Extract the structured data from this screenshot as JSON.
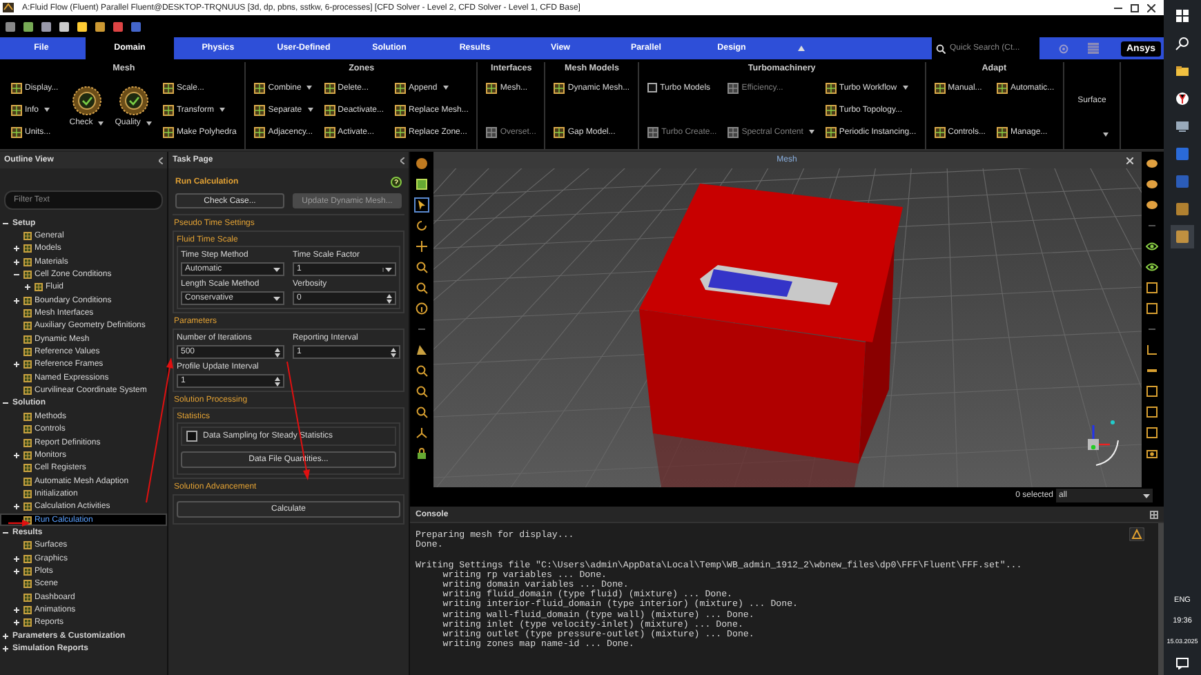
{
  "window": {
    "title": "A:Fluid Flow (Fluent) Parallel Fluent@DESKTOP-TRQNUUS  [3d, dp, pbns, sstkw, 6-processes] [CFD Solver - Level 2, CFD Solver - Level 1, CFD Base]"
  },
  "tabs": [
    {
      "label": "File",
      "selected": false
    },
    {
      "label": "Domain",
      "selected": true
    },
    {
      "label": "Physics",
      "selected": false
    },
    {
      "label": "User-Defined",
      "selected": false
    },
    {
      "label": "Solution",
      "selected": false
    },
    {
      "label": "Results",
      "selected": false
    },
    {
      "label": "View",
      "selected": false
    },
    {
      "label": "Parallel",
      "selected": false
    },
    {
      "label": "Design",
      "selected": false
    }
  ],
  "search": {
    "placeholder": "Quick Search (Ct..."
  },
  "brand": "Ansys",
  "ribbon": {
    "groups": [
      {
        "title": "Mesh",
        "kind": "full",
        "columns": [
          [
            {
              "label": "Display...",
              "kind": "small",
              "dropdown": false,
              "disabled": false
            },
            {
              "label": "Info",
              "kind": "small",
              "dropdown": true,
              "disabled": false
            },
            {
              "label": "Units...",
              "kind": "small",
              "dropdown": false,
              "disabled": false
            }
          ],
          [
            {
              "label": "Check",
              "kind": "large",
              "dropdown": true,
              "disabled": false
            }
          ],
          [
            {
              "label": "Quality",
              "kind": "large",
              "dropdown": true,
              "disabled": false
            }
          ],
          [
            {
              "label": "Scale...",
              "kind": "small",
              "dropdown": false,
              "disabled": false
            },
            {
              "label": "Transform",
              "kind": "small",
              "dropdown": true,
              "disabled": false
            },
            {
              "label": "Make Polyhedra",
              "kind": "small",
              "dropdown": false,
              "disabled": false
            }
          ]
        ]
      },
      {
        "title": "Zones",
        "kind": "full",
        "columns": [
          [
            {
              "label": "Combine",
              "kind": "small",
              "dropdown": true,
              "disabled": false
            },
            {
              "label": "Separate",
              "kind": "small",
              "dropdown": true,
              "disabled": false
            },
            {
              "label": "Adjacency...",
              "kind": "small",
              "dropdown": false,
              "disabled": false
            }
          ],
          [
            {
              "label": "Delete...",
              "kind": "small",
              "dropdown": false,
              "disabled": false
            },
            {
              "label": "Deactivate...",
              "kind": "small",
              "dropdown": false,
              "disabled": false
            },
            {
              "label": "Activate...",
              "kind": "small",
              "dropdown": false,
              "disabled": false
            }
          ],
          [
            {
              "label": "Append",
              "kind": "small",
              "dropdown": true,
              "disabled": false
            },
            {
              "label": "Replace Mesh...",
              "kind": "small",
              "dropdown": false,
              "disabled": false
            },
            {
              "label": "Replace Zone...",
              "kind": "small",
              "dropdown": false,
              "disabled": false
            }
          ]
        ]
      },
      {
        "title": "Interfaces",
        "kind": "full",
        "columns": [
          [
            {
              "label": "Mesh...",
              "kind": "small",
              "dropdown": false,
              "disabled": false
            },
            {
              "label": "Overset...",
              "kind": "small",
              "dropdown": false,
              "disabled": true
            }
          ]
        ]
      },
      {
        "title": "Mesh Models",
        "kind": "full",
        "columns": [
          [
            {
              "label": "Dynamic Mesh...",
              "kind": "small",
              "dropdown": false,
              "disabled": false
            },
            {
              "label": "Gap Model...",
              "kind": "small",
              "dropdown": false,
              "disabled": false
            }
          ]
        ]
      },
      {
        "title": "Turbomachinery",
        "kind": "full",
        "columns": [
          [
            {
              "label": "Turbo Models",
              "kind": "checkbox",
              "checked": false,
              "disabled": false
            },
            {
              "label": "Turbo Create...",
              "kind": "small",
              "dropdown": false,
              "disabled": true
            }
          ],
          [
            {
              "label": "Efficiency...",
              "kind": "small",
              "dropdown": false,
              "disabled": true
            },
            {
              "label": "Spectral Content",
              "kind": "small",
              "dropdown": true,
              "disabled": true
            }
          ],
          [
            {
              "label": "Turbo Workflow",
              "kind": "small",
              "dropdown": true,
              "disabled": false
            },
            {
              "label": "Turbo Topology...",
              "kind": "small",
              "dropdown": false,
              "disabled": false
            },
            {
              "label": "Periodic Instancing...",
              "kind": "small",
              "dropdown": false,
              "disabled": false
            }
          ]
        ]
      },
      {
        "title": "Adapt",
        "kind": "full",
        "columns": [
          [
            {
              "label": "Manual...",
              "kind": "small",
              "dropdown": false,
              "disabled": false
            },
            {
              "label": "Controls...",
              "kind": "small",
              "dropdown": false,
              "disabled": false
            }
          ],
          [
            {
              "label": "Automatic...",
              "kind": "small",
              "dropdown": false,
              "disabled": false
            },
            {
              "label": "Manage...",
              "kind": "small",
              "dropdown": false,
              "disabled": false
            }
          ]
        ]
      },
      {
        "title": "Surface",
        "kind": "collapsed"
      }
    ]
  },
  "outline": {
    "title": "Outline View",
    "filter": {
      "placeholder": "Filter Text"
    },
    "tree": [
      {
        "label": "Setup",
        "expanded": true,
        "selected": false,
        "children": [
          {
            "label": "General",
            "selected": false
          },
          {
            "label": "Models",
            "expanded": false,
            "selected": false
          },
          {
            "label": "Materials",
            "expanded": false,
            "selected": false
          },
          {
            "label": "Cell Zone Conditions",
            "expanded": true,
            "selected": false,
            "children": [
              {
                "label": "Fluid",
                "expanded": false,
                "selected": false
              }
            ]
          },
          {
            "label": "Boundary Conditions",
            "expanded": false,
            "selected": false
          },
          {
            "label": "Mesh Interfaces",
            "selected": false
          },
          {
            "label": "Auxiliary Geometry Definitions",
            "selected": false
          },
          {
            "label": "Dynamic Mesh",
            "selected": false
          },
          {
            "label": "Reference Values",
            "selected": false
          },
          {
            "label": "Reference Frames",
            "expanded": false,
            "selected": false
          },
          {
            "label": "Named Expressions",
            "selected": false
          },
          {
            "label": "Curvilinear Coordinate System",
            "selected": false
          }
        ]
      },
      {
        "label": "Solution",
        "expanded": true,
        "selected": false,
        "children": [
          {
            "label": "Methods",
            "selected": false
          },
          {
            "label": "Controls",
            "selected": false
          },
          {
            "label": "Report Definitions",
            "selected": false
          },
          {
            "label": "Monitors",
            "expanded": false,
            "selected": false
          },
          {
            "label": "Cell Registers",
            "selected": false
          },
          {
            "label": "Automatic Mesh Adaption",
            "selected": false
          },
          {
            "label": "Initialization",
            "selected": false
          },
          {
            "label": "Calculation Activities",
            "expanded": false,
            "selected": false
          },
          {
            "label": "Run Calculation",
            "selected": true
          }
        ]
      },
      {
        "label": "Results",
        "expanded": true,
        "selected": false,
        "children": [
          {
            "label": "Surfaces",
            "selected": false
          },
          {
            "label": "Graphics",
            "expanded": false,
            "selected": false
          },
          {
            "label": "Plots",
            "expanded": false,
            "selected": false
          },
          {
            "label": "Scene",
            "selected": false
          },
          {
            "label": "Dashboard",
            "selected": false
          },
          {
            "label": "Animations",
            "expanded": false,
            "selected": false
          },
          {
            "label": "Reports",
            "expanded": false,
            "selected": false
          }
        ]
      },
      {
        "label": "Parameters & Customization",
        "expanded": false,
        "selected": false
      },
      {
        "label": "Simulation Reports",
        "expanded": false,
        "selected": false
      }
    ]
  },
  "task_page": {
    "title": "Task Page",
    "heading": "Run Calculation",
    "top_buttons": [
      {
        "label": "Check Case...",
        "disabled": false
      },
      {
        "label": "Update Dynamic Mesh...",
        "disabled": true
      }
    ],
    "sections": [
      {
        "title": "Pseudo Time Settings",
        "box_title": "Fluid Time Scale",
        "items": [
          {
            "kind": "dropdown",
            "label": "Time Step Method",
            "value": "Automatic"
          },
          {
            "kind": "combo",
            "label": "Time Scale Factor",
            "value": "1"
          },
          {
            "kind": "dropdown",
            "label": "Length Scale Method",
            "value": "Conservative"
          },
          {
            "kind": "spinner",
            "label": "Verbosity",
            "value": "0"
          }
        ]
      },
      {
        "title": "Parameters",
        "items": [
          {
            "kind": "spinner",
            "label": "Number of Iterations",
            "value": "500"
          },
          {
            "kind": "spinner",
            "label": "Reporting Interval",
            "value": "1"
          },
          {
            "kind": "spinner",
            "label": "Profile Update Interval",
            "value": "1"
          }
        ]
      },
      {
        "title": "Solution Processing",
        "box_title": "Statistics",
        "items": [
          {
            "kind": "checkbox",
            "label": "Data Sampling for Steady Statistics",
            "checked": false
          },
          {
            "kind": "button",
            "label": "Data File Quantities..."
          }
        ]
      },
      {
        "title": "Solution Advancement",
        "items": [
          {
            "kind": "button",
            "label": "Calculate"
          }
        ]
      }
    ]
  },
  "viewport": {
    "title": "Mesh",
    "selection_count": "0 selected",
    "selection_filter": "all"
  },
  "console": {
    "title": "Console",
    "blocks": [
      [
        "Preparing mesh for display...",
        "Done."
      ],
      [
        "Writing Settings file \"C:\\Users\\admin\\AppData\\Local\\Temp\\WB_admin_1912_2\\wbnew_files\\dp0\\FFF\\Fluent\\FFF.set\"...",
        "     writing rp variables ... Done.",
        "     writing domain variables ... Done.",
        "     writing fluid_domain (type fluid) (mixture) ... Done.",
        "     writing interior-fluid_domain (type interior) (mixture) ... Done.",
        "     writing wall-fluid_domain (type wall) (mixture) ... Done.",
        "     writing inlet (type velocity-inlet) (mixture) ... Done.",
        "     writing outlet (type pressure-outlet) (mixture) ... Done.",
        "     writing zones map name-id ... Done."
      ]
    ]
  },
  "taskbar": {
    "language": "ENG",
    "time": "19:36",
    "date": "15.03.2025"
  }
}
